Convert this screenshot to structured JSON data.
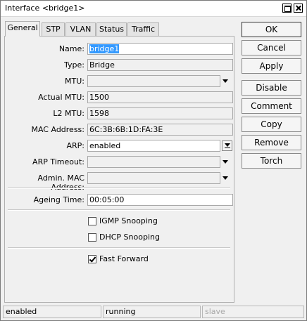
{
  "window": {
    "title": "Interface <bridge1>"
  },
  "tabs": [
    {
      "label": "General"
    },
    {
      "label": "STP"
    },
    {
      "label": "VLAN"
    },
    {
      "label": "Status"
    },
    {
      "label": "Traffic"
    }
  ],
  "form": {
    "name": {
      "label": "Name:",
      "value": "bridge1"
    },
    "type": {
      "label": "Type:",
      "value": "Bridge"
    },
    "mtu": {
      "label": "MTU:",
      "value": ""
    },
    "actual_mtu": {
      "label": "Actual MTU:",
      "value": "1500"
    },
    "l2_mtu": {
      "label": "L2 MTU:",
      "value": "1598"
    },
    "mac_address": {
      "label": "MAC Address:",
      "value": "6C:3B:6B:1D:FA:3E"
    },
    "arp": {
      "label": "ARP:",
      "value": "enabled"
    },
    "arp_timeout": {
      "label": "ARP Timeout:",
      "value": ""
    },
    "admin_mac": {
      "label": "Admin. MAC Address:",
      "value": ""
    },
    "ageing_time": {
      "label": "Ageing Time:",
      "value": "00:05:00"
    },
    "igmp_snooping": {
      "label": "IGMP Snooping",
      "checked": false
    },
    "dhcp_snooping": {
      "label": "DHCP Snooping",
      "checked": false
    },
    "fast_forward": {
      "label": "Fast Forward",
      "checked": true
    }
  },
  "buttons": {
    "ok": "OK",
    "cancel": "Cancel",
    "apply": "Apply",
    "disable": "Disable",
    "comment": "Comment",
    "copy": "Copy",
    "remove": "Remove",
    "torch": "Torch"
  },
  "status": {
    "state": "enabled",
    "run": "running",
    "slave": "slave"
  }
}
